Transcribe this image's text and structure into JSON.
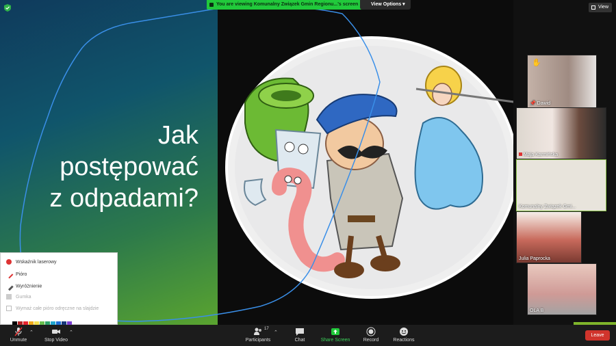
{
  "share_banner": {
    "text": "You are viewing Komunalny Związek Gmin Regionu...'s screen"
  },
  "view_options": {
    "label": "View Options"
  },
  "view_button": {
    "label": "View"
  },
  "slide": {
    "title_lines": [
      "Jak",
      "postępować",
      "z odpadami?"
    ]
  },
  "participants_panel": [
    {
      "name": "Dawid",
      "pinned": true
    },
    {
      "name": "Maja Karmińska"
    },
    {
      "name": "Komunalny Związek Gmi..."
    },
    {
      "name": "Julia Paprocka"
    },
    {
      "name": "OLA B"
    }
  ],
  "annotation_menu": {
    "items": [
      {
        "label": "Wskaźnik laserowy",
        "icon": "laser-icon",
        "disabled": false
      },
      {
        "label": "Pióro",
        "icon": "pen-icon",
        "disabled": false
      },
      {
        "label": "Wyróżnienie",
        "icon": "highlighter-icon",
        "disabled": false
      },
      {
        "label": "Gumka",
        "icon": "eraser-icon",
        "disabled": true
      },
      {
        "label": "Wymaż całe pióro odręczne na slajdzie",
        "icon": "clear-icon",
        "disabled": true
      }
    ],
    "colors": [
      "#000000",
      "#b22222",
      "#e8232f",
      "#f0a91a",
      "#f4e04d",
      "#6ac04f",
      "#2ea36a",
      "#22a7d0",
      "#1e6fd8",
      "#18397a",
      "#7a3fd1"
    ]
  },
  "toolbar": {
    "unmute": "Unmute",
    "stop_video": "Stop Video",
    "participants": "Participants",
    "participants_count": "17",
    "chat": "Chat",
    "share_screen": "Share Screen",
    "record": "Record",
    "reactions": "Reactions",
    "leave": "Leave"
  },
  "colors": {
    "share_green": "#21c93b",
    "leave_red": "#d0342c",
    "annotation_blue": "#3a8fe8"
  }
}
